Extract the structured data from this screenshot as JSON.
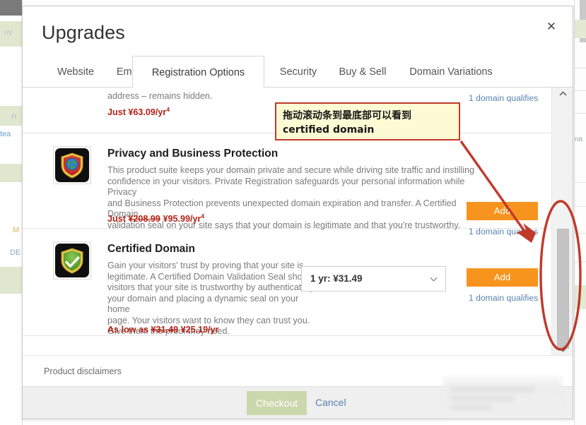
{
  "dialog": {
    "title": "Upgrades",
    "close_icon": "close-icon",
    "close_label": "✕"
  },
  "tabs": [
    {
      "label": "Website",
      "active": false
    },
    {
      "label": "Email",
      "active": false
    },
    {
      "label": "Registration Options",
      "active": true
    },
    {
      "label": "Security",
      "active": false
    },
    {
      "label": "Buy & Sell",
      "active": false
    },
    {
      "label": "Domain Variations",
      "active": false
    }
  ],
  "products": [
    {
      "name": "partial-top-row",
      "title": "",
      "desc_lines": [
        "address – remains hidden."
      ],
      "price_prefix": "Just",
      "price_old": "",
      "price_new": "¥63.09/yr",
      "price_sup": "4",
      "qualifies": "1 domain qualifies",
      "add_label": "",
      "term": ""
    },
    {
      "name": "privacy-and-business-protection",
      "title": "Privacy and Business Protection",
      "desc_lines": [
        "This product suite keeps your domain private and secure while driving site traffic and instilling",
        "confidence in your visitors. Private Registration safeguards your personal information while Privacy",
        "and Business Protection prevents unexpected domain expiration and transfer. A Certified Domain",
        "validation seal on your site says that your domain is legitimate and that you're trustworthy."
      ],
      "price_prefix": "Just",
      "price_old": "¥208.99",
      "price_new": "¥95.99/yr",
      "price_sup": "4",
      "qualifies": "1 domain qualifies",
      "add_label": "Add",
      "term": "",
      "icon": "shield-globe-icon"
    },
    {
      "name": "certified-domain",
      "title": "Certified Domain",
      "desc_lines": [
        "Gain your visitors' trust by proving that your site is",
        "legitimate. A Certified Domain Validation Seal shows",
        "visitors that your site is trustworthy by authenticating",
        "your domain and placing a dynamic seal on your home",
        "page. Your visitors want to know they can trust you.",
        "Give them the proof they need."
      ],
      "price_prefix": "As low as",
      "price_old": "¥31.49",
      "price_new": "¥25.19/yr",
      "price_sup": "",
      "qualifies": "1 domain qualifies",
      "add_label": "Add",
      "term": "1 yr: ¥31.49",
      "icon": "shield-check-icon"
    }
  ],
  "scrollbar": {
    "up_icon": "chevron-up-icon",
    "down_icon": "chevron-down-icon"
  },
  "footer": {
    "disclaimers_label": "Product disclaimers",
    "checkout_label": "Checkout",
    "cancel_label": "Cancel"
  },
  "annotation": {
    "text": "拖动滚动条到最底部可以看到certified domain",
    "border_color": "#c0392b",
    "fill_color": "#fdfbd4",
    "arrow_color": "#c0392b",
    "highlight_shape": "ellipse"
  },
  "colors": {
    "accent_orange": "#f7941e",
    "link_blue": "#5a83b0",
    "price_red": "#b32317",
    "checkout_green": "#cbd8ad"
  },
  "background": {
    "ghost_labels": [
      "uy",
      "R",
      "tea",
      "M",
      "DE"
    ]
  }
}
